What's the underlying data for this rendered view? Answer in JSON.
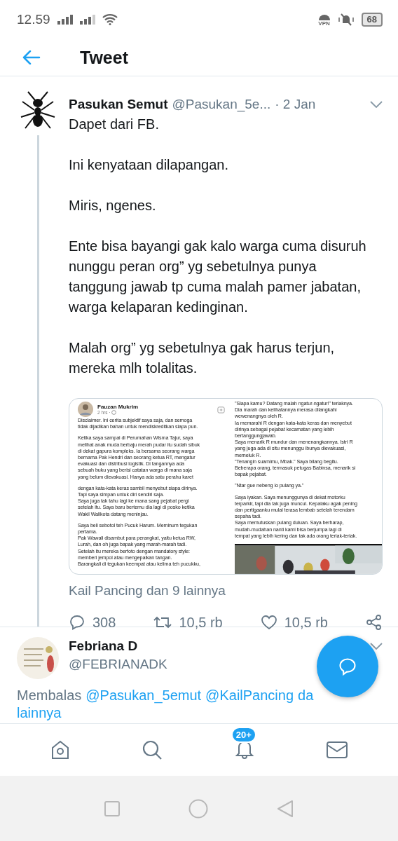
{
  "status_bar": {
    "time": "12.59",
    "vpn": "VPN",
    "battery": "68"
  },
  "header": {
    "title": "Tweet"
  },
  "tweet": {
    "name": "Pasukan Semut",
    "handle": "@Pasukan_5e...",
    "time": "· 2 Jan",
    "paragraphs": [
      "Dapet dari FB.",
      "Ini kenyataan dilapangan.",
      "Miris, ngenes.",
      "Ente bisa bayangi gak kalo warga cuma disuruh nunggu peran org” yg sebetulnya punya tanggung jawab tp cuma malah pamer jabatan, warga kelaparan kedinginan.",
      "Malah org” yg sebetulnya gak harus terjun, mereka mlh tolalitas."
    ],
    "attachment": {
      "author": "Fauzan Mukrim",
      "posted": "2 hrs ·",
      "left": [
        "Disclaimer. Ini cerita subjektif saya saja, dan semoga\ntidak dijadikan bahan untuk mendiskreditkan siapa pun.",
        "Ketika saya sampai di Perumahan Wisma Tajur, saya\nmelihat anak muda berbaju merah pudar itu sudah sibuk\ndi dekat gapura kompleks. Ia bersama seorang warga\nbernama Pak Hendri dan seorang ketua RT, mengatur\nevakuasi dan distribusi logistik. Di tangannya ada\nsebuah buku yang berisi catatan warga di mana saja\nyang belum dievakuasi. Hanya ada satu perahu karet",
        "dengan kata-kata keras sambil menyebut siapa dirinya.\nTapi saya simpan untuk diri sendiri saja.\nSaya juga tak tahu lagi ke mana sang pejabat pergi\nsetelah itu. Saya baru bertemu dia lagi di posko ketika\nWakil Walikota datang meninjau.",
        "Saya beli sebotol teh Pucuk Harum. Meminum tegukan\npertama.\nPak Wawali disambut para perangkat, yaitu ketua RW,\nLurah, dan oh juga bapak yang marah-marah tadi.\nSetelah itu mereka berfoto dengan mandatory style:\nmemberi jempol atau mengepalkan tangan.\nBarangkali di tegukan keempat atau kelima teh pucukku,"
      ],
      "right": [
        "\"Siapa kamu? Datang malah ngatur-ngatur!\" teriaknya.\nDia marah dan kelihatannya merasa dilangkahi\nwewenangnya oleh R.\nIa memarahi R dengan kata-kata keras dan menyebut\ndirinya sebagai pejabat kecamatan yang lebih\nbertanggungjawab.\nSaya menarik R mundur dan menenangkannya. Istri R\nyang juga ada di situ menunggu ibunya dievakuasi,\nmemeluk R.\n\"Tenangin suamimu, Mbak.\" Saya bilang begitu.\nBeberapa orang, termasuk petugas Babinsa, menarik si\nbapak pejabat.",
        "\"Ntar gue nebeng lo pulang ya.\"",
        "Saya iyakan. Saya menunggunya di dekat motorku\nterparkir, tapi dia tak juga muncul. Kepalaku agak pening\ndan pertigaanku mulai terasa lembab setelah terendam\nsepaha tadi.\nSaya memutuskan pulang duluan. Saya berharap,\nmudah-mudahan nanti kami bisa berjumpa lagi di\ntempat yang lebih kering dan tak ada orang teriak-teriak."
      ]
    },
    "liked_by": "Kail Pancing dan 9 lainnya",
    "actions": [
      {
        "kind": "reply",
        "count": "308"
      },
      {
        "kind": "retweet",
        "count": "10,5 rb"
      },
      {
        "kind": "like",
        "count": "10,5 rb"
      },
      {
        "kind": "share"
      }
    ]
  },
  "reply": {
    "name": "Febriana D",
    "handle": "@FEBRIANADK",
    "prefix": "Membalas",
    "mentions": [
      "@Pasukan_5emut",
      "@KailPancing"
    ],
    "tail": "da",
    "tail2": "lainnya"
  },
  "bottom_nav": [
    {
      "kind": "home",
      "selected": false
    },
    {
      "kind": "search",
      "selected": false
    },
    {
      "kind": "notifications",
      "selected": false,
      "badge": "20+"
    },
    {
      "kind": "messages",
      "selected": false
    }
  ]
}
